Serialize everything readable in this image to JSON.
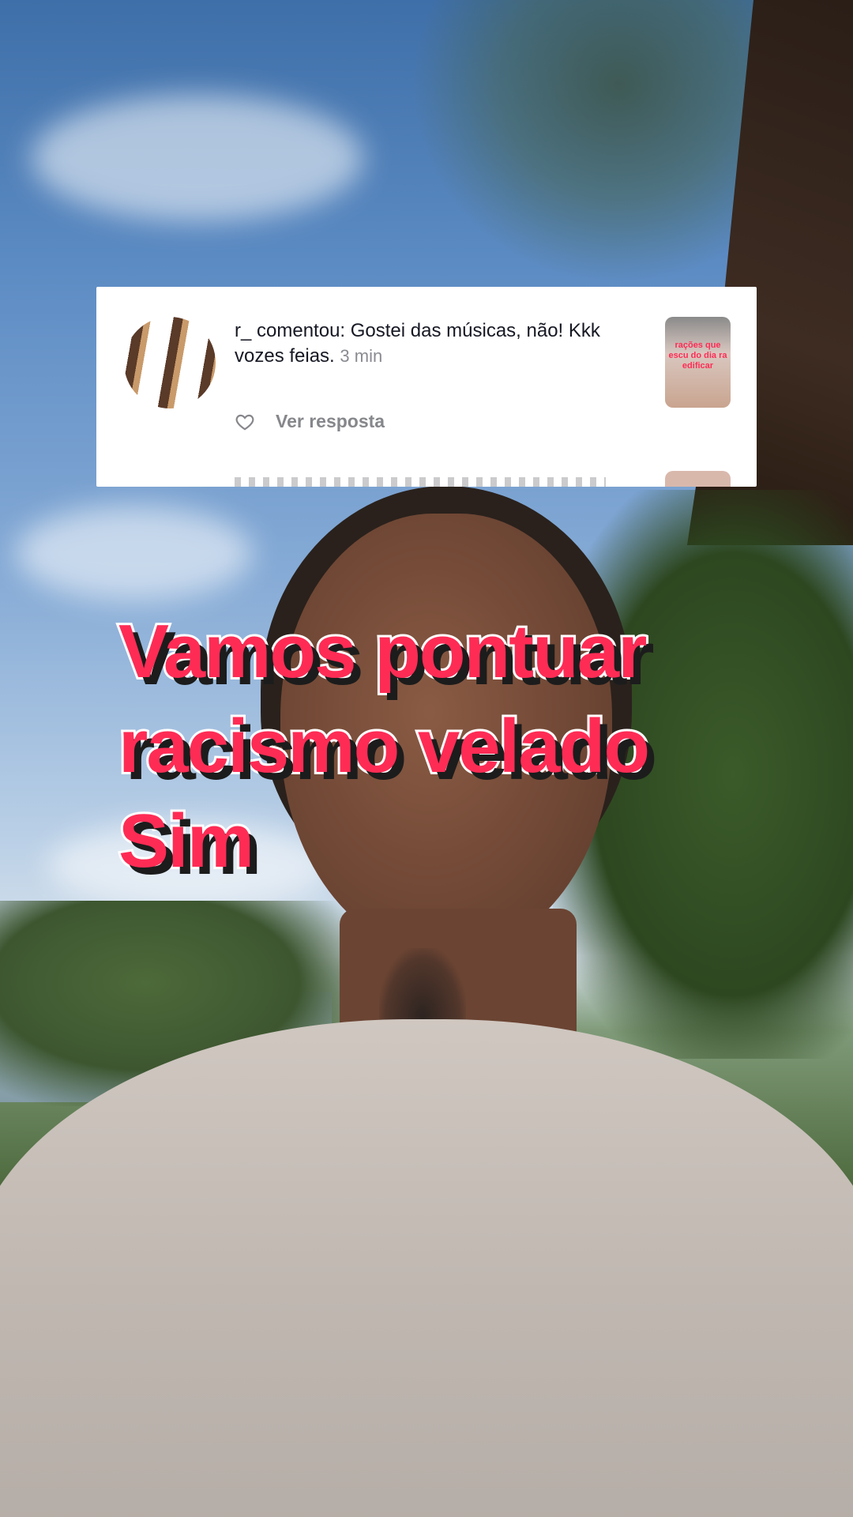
{
  "comment": {
    "username": "r_",
    "text_prefix": " comentou: Gostei das músicas, não! Kkk vozes feias.",
    "time": "3 min",
    "reply_label": "Ver resposta",
    "thumbnail_caption": "rações que escu do dia ra edificar",
    "icons": {
      "like": "heart-icon"
    }
  },
  "caption": {
    "lines": [
      "Vamos pontuar",
      "racismo velado",
      "Sim"
    ]
  },
  "colors": {
    "caption_fill": "#fe2c55",
    "caption_outline": "#ffffff",
    "caption_shadow": "#1c1c1c",
    "card_background": "#ffffff",
    "comment_text": "#161823",
    "muted_text": "#86878b"
  }
}
